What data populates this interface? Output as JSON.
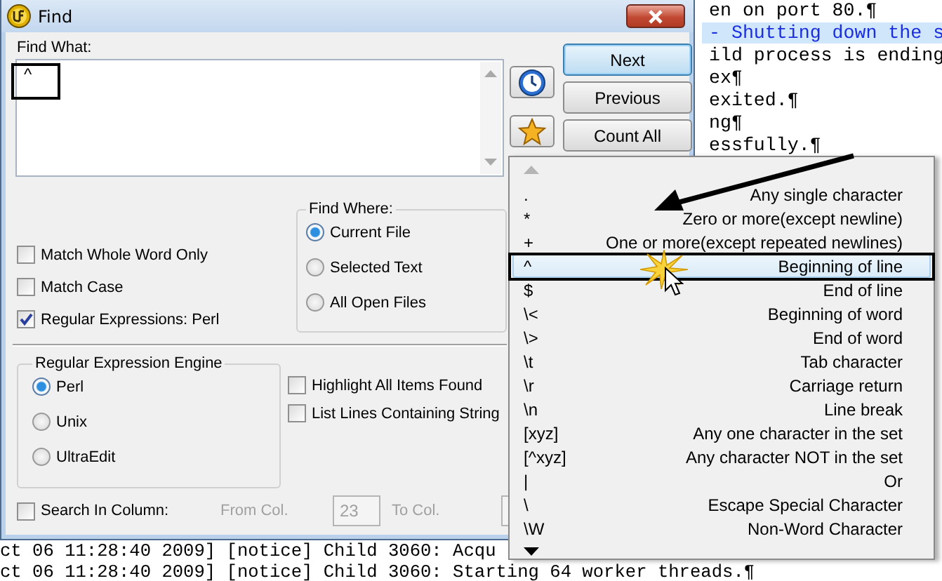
{
  "editor": {
    "lines": [
      {
        "text": "en on port 80.¶",
        "highlighted": false
      },
      {
        "text": "- Shutting down the s",
        "highlighted": true
      },
      {
        "text": "ild process is ending",
        "highlighted": false
      },
      {
        "text": "ex¶",
        "highlighted": false
      },
      {
        "text": "exited.¶",
        "highlighted": false
      },
      {
        "text": "ng¶",
        "highlighted": false
      },
      {
        "text": "essfully.¶",
        "highlighted": false
      },
      {
        "text": "ct 06 11:28:40 2009] [notice] Child 3060: Acqu",
        "highlighted": false
      },
      {
        "text": "ct 06 11:28:40 2009] [notice] Child 3060: Starting 64 worker threads.¶",
        "highlighted": false
      }
    ]
  },
  "dialog": {
    "title": "Find",
    "find_what": {
      "label": "Find What:",
      "value": "^"
    },
    "buttons": [
      {
        "label": "Next",
        "default": true
      },
      {
        "label": "Previous",
        "default": false
      },
      {
        "label": "Count All",
        "default": false
      }
    ],
    "options": [
      {
        "label": "Match Whole Word Only",
        "checked": false
      },
      {
        "label": "Match Case",
        "checked": false
      },
      {
        "label": "Regular Expressions: Perl",
        "checked": true
      }
    ],
    "find_where": {
      "title": "Find Where:",
      "options": [
        {
          "label": "Current File",
          "selected": true
        },
        {
          "label": "Selected Text",
          "selected": false
        },
        {
          "label": "All Open Files",
          "selected": false
        }
      ]
    },
    "regex_engine": {
      "title": "Regular Expression Engine",
      "options": [
        {
          "label": "Perl",
          "selected": true
        },
        {
          "label": "Unix",
          "selected": false
        },
        {
          "label": "UltraEdit",
          "selected": false
        }
      ]
    },
    "extra_options": [
      {
        "label": "Highlight All Items Found",
        "checked": false
      },
      {
        "label": "List Lines Containing String",
        "checked": false
      }
    ],
    "search_in_column": {
      "label": "Search In Column:",
      "checked": false,
      "from_label": "From Col.",
      "from_value": "23",
      "to_label": "To Col."
    }
  },
  "regex_menu": {
    "items": [
      {
        "token": ".",
        "description": "Any single character",
        "selected": false
      },
      {
        "token": "*",
        "description": "Zero or more(except newline)",
        "selected": false
      },
      {
        "token": "+",
        "description": "One or more(except repeated newlines)",
        "selected": false
      },
      {
        "token": "^",
        "description": "Beginning of line",
        "selected": true
      },
      {
        "token": "$",
        "description": "End of line",
        "selected": false
      },
      {
        "token": "\\<",
        "description": "Beginning of word",
        "selected": false
      },
      {
        "token": "\\>",
        "description": "End of word",
        "selected": false
      },
      {
        "token": "\\t",
        "description": "Tab character",
        "selected": false
      },
      {
        "token": "\\r",
        "description": "Carriage return",
        "selected": false
      },
      {
        "token": "\\n",
        "description": "Line break",
        "selected": false
      },
      {
        "token": "[xyz]",
        "description": "Any one character in the set",
        "selected": false
      },
      {
        "token": "[^xyz]",
        "description": "Any character NOT in the set",
        "selected": false
      },
      {
        "token": "|",
        "description": "Or",
        "selected": false
      },
      {
        "token": "\\",
        "description": "Escape Special Character",
        "selected": false
      },
      {
        "token": "\\W",
        "description": "Non-Word Character",
        "selected": false
      }
    ]
  }
}
